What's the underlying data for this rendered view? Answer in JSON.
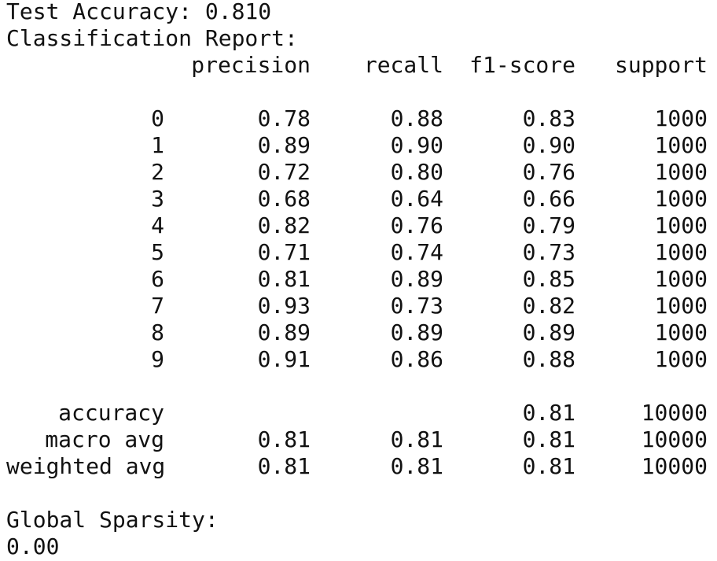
{
  "output": {
    "accuracy_line": "Test Accuracy: 0.810",
    "report_title": "Classification Report:",
    "headers": [
      "precision",
      "recall",
      "f1-score",
      "support"
    ],
    "class_rows": [
      {
        "label": "0",
        "precision": "0.78",
        "recall": "0.88",
        "f1": "0.83",
        "support": "1000"
      },
      {
        "label": "1",
        "precision": "0.89",
        "recall": "0.90",
        "f1": "0.90",
        "support": "1000"
      },
      {
        "label": "2",
        "precision": "0.72",
        "recall": "0.80",
        "f1": "0.76",
        "support": "1000"
      },
      {
        "label": "3",
        "precision": "0.68",
        "recall": "0.64",
        "f1": "0.66",
        "support": "1000"
      },
      {
        "label": "4",
        "precision": "0.82",
        "recall": "0.76",
        "f1": "0.79",
        "support": "1000"
      },
      {
        "label": "5",
        "precision": "0.71",
        "recall": "0.74",
        "f1": "0.73",
        "support": "1000"
      },
      {
        "label": "6",
        "precision": "0.81",
        "recall": "0.89",
        "f1": "0.85",
        "support": "1000"
      },
      {
        "label": "7",
        "precision": "0.93",
        "recall": "0.73",
        "f1": "0.82",
        "support": "1000"
      },
      {
        "label": "8",
        "precision": "0.89",
        "recall": "0.89",
        "f1": "0.89",
        "support": "1000"
      },
      {
        "label": "9",
        "precision": "0.91",
        "recall": "0.86",
        "f1": "0.88",
        "support": "1000"
      }
    ],
    "summary_rows": [
      {
        "label": "accuracy",
        "precision": "",
        "recall": "",
        "f1": "0.81",
        "support": "10000"
      },
      {
        "label": "macro avg",
        "precision": "0.81",
        "recall": "0.81",
        "f1": "0.81",
        "support": "10000"
      },
      {
        "label": "weighted avg",
        "precision": "0.81",
        "recall": "0.81",
        "f1": "0.81",
        "support": "10000"
      }
    ],
    "sparsity_title": "Global Sparsity:",
    "sparsity_value": "0.00"
  }
}
